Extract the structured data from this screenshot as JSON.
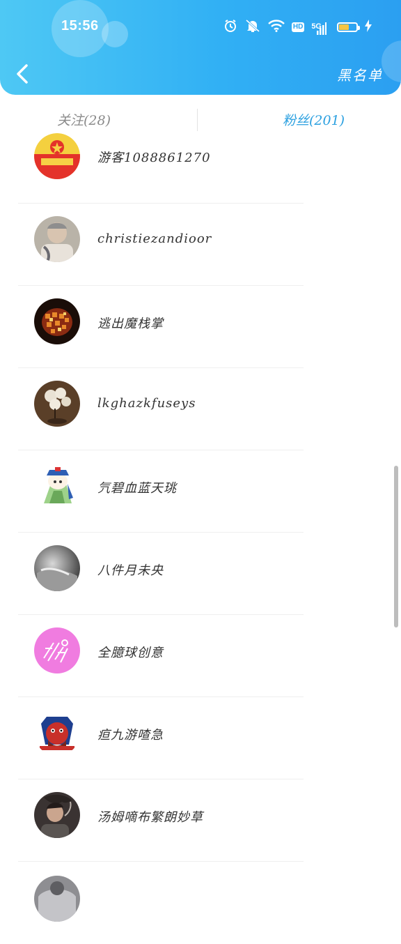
{
  "status_bar": {
    "time": "15:56",
    "network": "5G"
  },
  "header": {
    "blacklist_label": "黑名单"
  },
  "tabs": [
    {
      "label": "关注(28)",
      "active": false
    },
    {
      "label": "粉丝(201)",
      "active": true
    }
  ],
  "fans": [
    {
      "name": "游客1088861270"
    },
    {
      "name": "christiezandioor"
    },
    {
      "name": "逃出魔栈掌"
    },
    {
      "name": "lkghazkfuseys"
    },
    {
      "name": "氕碧血蓝天珧"
    },
    {
      "name": "八件月未央"
    },
    {
      "name": "全臆球创意"
    },
    {
      "name": "疸九游喳急"
    },
    {
      "name": "汤姆嘀布繁朗妙草"
    },
    {
      "name": ""
    }
  ],
  "colors": {
    "accent": "#2ba0e0",
    "header_start": "#4ec8f4",
    "header_end": "#2b9ff1"
  }
}
